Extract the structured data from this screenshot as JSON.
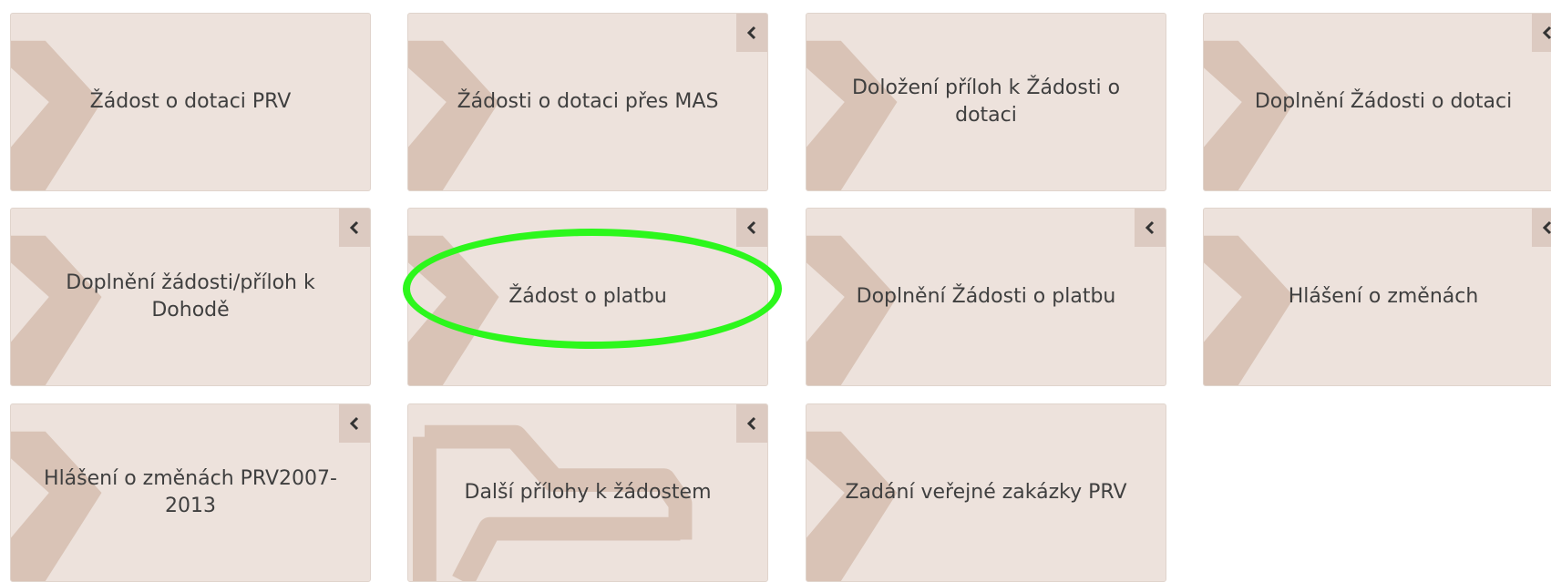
{
  "tiles": [
    {
      "label": "Žádost o dotaci PRV",
      "has_collapse": false,
      "bg": "chevron"
    },
    {
      "label": "Žádosti o dotaci přes MAS",
      "has_collapse": true,
      "bg": "chevron"
    },
    {
      "label": "Doložení příloh k Žádosti o dotaci",
      "has_collapse": false,
      "bg": "chevron"
    },
    {
      "label": "Doplnění Žádosti o dotaci",
      "has_collapse": true,
      "bg": "chevron"
    },
    {
      "label": "Doplnění žádosti/příloh k Dohodě",
      "has_collapse": true,
      "bg": "chevron"
    },
    {
      "label": "Žádost o platbu",
      "has_collapse": true,
      "bg": "chevron"
    },
    {
      "label": "Doplnění Žádosti o platbu",
      "has_collapse": true,
      "bg": "chevron"
    },
    {
      "label": "Hlášení o změnách",
      "has_collapse": true,
      "bg": "chevron"
    },
    {
      "label": "Hlášení o změnách PRV2007-2013",
      "has_collapse": true,
      "bg": "chevron"
    },
    {
      "label": "Další přílohy k žádostem",
      "has_collapse": true,
      "bg": "folder"
    },
    {
      "label": "Zadání veřejné zakázky PRV",
      "has_collapse": false,
      "bg": "chevron"
    }
  ],
  "icons": {
    "collapse": "chevron-left-icon",
    "background": "chevron-right-icon",
    "folder": "folder-icon"
  },
  "colors": {
    "tile_bg": "#ede2dc",
    "tile_shape": "#d9c3b6",
    "collapse_bg": "#dccac1",
    "highlight": "#2cf71c",
    "text": "#3f3f3f"
  },
  "highlight": {
    "target_tile": "Žádost o platbu"
  }
}
